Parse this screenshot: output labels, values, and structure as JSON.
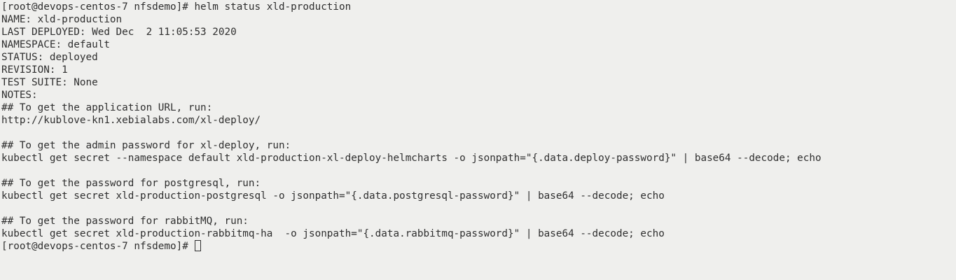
{
  "terminal": {
    "lines": [
      "[root@devops-centos-7 nfsdemo]# helm status xld-production",
      "NAME: xld-production",
      "LAST DEPLOYED: Wed Dec  2 11:05:53 2020",
      "NAMESPACE: default",
      "STATUS: deployed",
      "REVISION: 1",
      "TEST SUITE: None",
      "NOTES:",
      "## To get the application URL, run:",
      "http://kublove-kn1.xebialabs.com/xl-deploy/",
      "",
      "## To get the admin password for xl-deploy, run:",
      "kubectl get secret --namespace default xld-production-xl-deploy-helmcharts -o jsonpath=\"{.data.deploy-password}\" | base64 --decode; echo",
      "",
      "## To get the password for postgresql, run:",
      "kubectl get secret xld-production-postgresql -o jsonpath=\"{.data.postgresql-password}\" | base64 --decode; echo",
      "",
      "## To get the password for rabbitMQ, run:",
      "kubectl get secret xld-production-rabbitmq-ha  -o jsonpath=\"{.data.rabbitmq-password}\" | base64 --decode; echo"
    ],
    "prompt": "[root@devops-centos-7 nfsdemo]# ",
    "colors": {
      "background": "#efefed",
      "text": "#2f2f2f"
    }
  }
}
